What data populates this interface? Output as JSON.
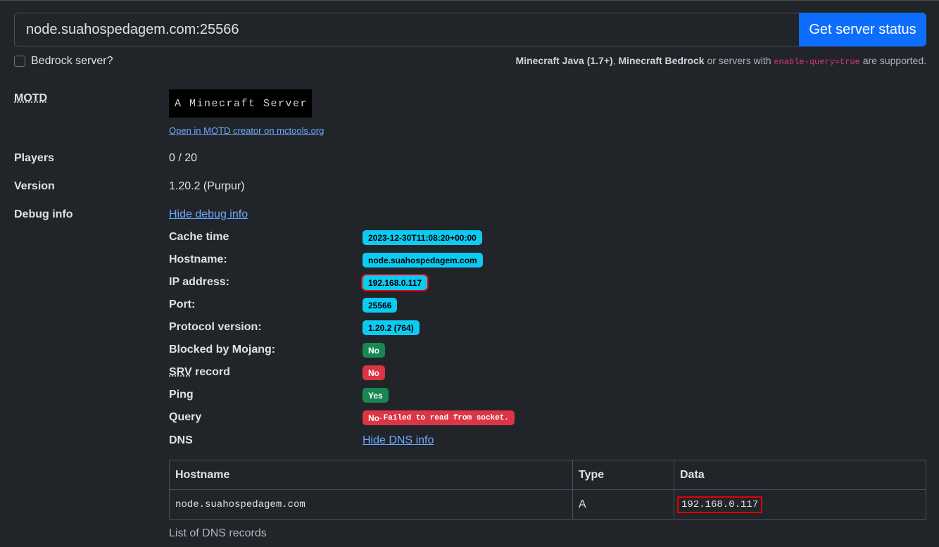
{
  "search": {
    "value": "node.suahospedagem.com:25566",
    "button_label": "Get server status"
  },
  "bedrock": {
    "label": "Bedrock server?",
    "checked": false
  },
  "supported": {
    "java": "Minecraft Java (1.7+)",
    "sep1": ", ",
    "bedrock": "Minecraft Bedrock",
    "mid": " or servers with ",
    "code": "enable-query=true",
    "end": " are supported."
  },
  "motd": {
    "label": "MOTD",
    "text": "A Minecraft Server",
    "link": "Open in MOTD creator on mctools.org"
  },
  "players": {
    "label": "Players",
    "value": "0 / 20"
  },
  "version": {
    "label": "Version",
    "value": "1.20.2 (Purpur)"
  },
  "debug": {
    "label": "Debug info",
    "toggle": "Hide debug info",
    "cache_time": {
      "label": "Cache time",
      "value": "2023-12-30T11:08:20+00:00"
    },
    "hostname": {
      "label": "Hostname:",
      "value": "node.suahospedagem.com"
    },
    "ip": {
      "label": "IP address:",
      "value": "192.168.0.117"
    },
    "port": {
      "label": "Port:",
      "value": "25566"
    },
    "protocol": {
      "label": "Protocol version:",
      "value": "1.20.2 (764)"
    },
    "blocked": {
      "label": "Blocked by Mojang:",
      "value": "No"
    },
    "srv": {
      "label_abbr": "SRV",
      "label_rest": " record",
      "value": "No"
    },
    "ping": {
      "label": "Ping",
      "value": "Yes"
    },
    "query": {
      "label": "Query",
      "value": "No",
      "sep": " - ",
      "error": "Failed to read from socket."
    },
    "dns": {
      "label": "DNS",
      "toggle": "Hide DNS info"
    }
  },
  "dns_table": {
    "headers": [
      "Hostname",
      "Type",
      "Data"
    ],
    "rows": [
      [
        "node.suahospedagem.com",
        "A",
        "192.168.0.117"
      ]
    ],
    "caption": "List of DNS records"
  }
}
